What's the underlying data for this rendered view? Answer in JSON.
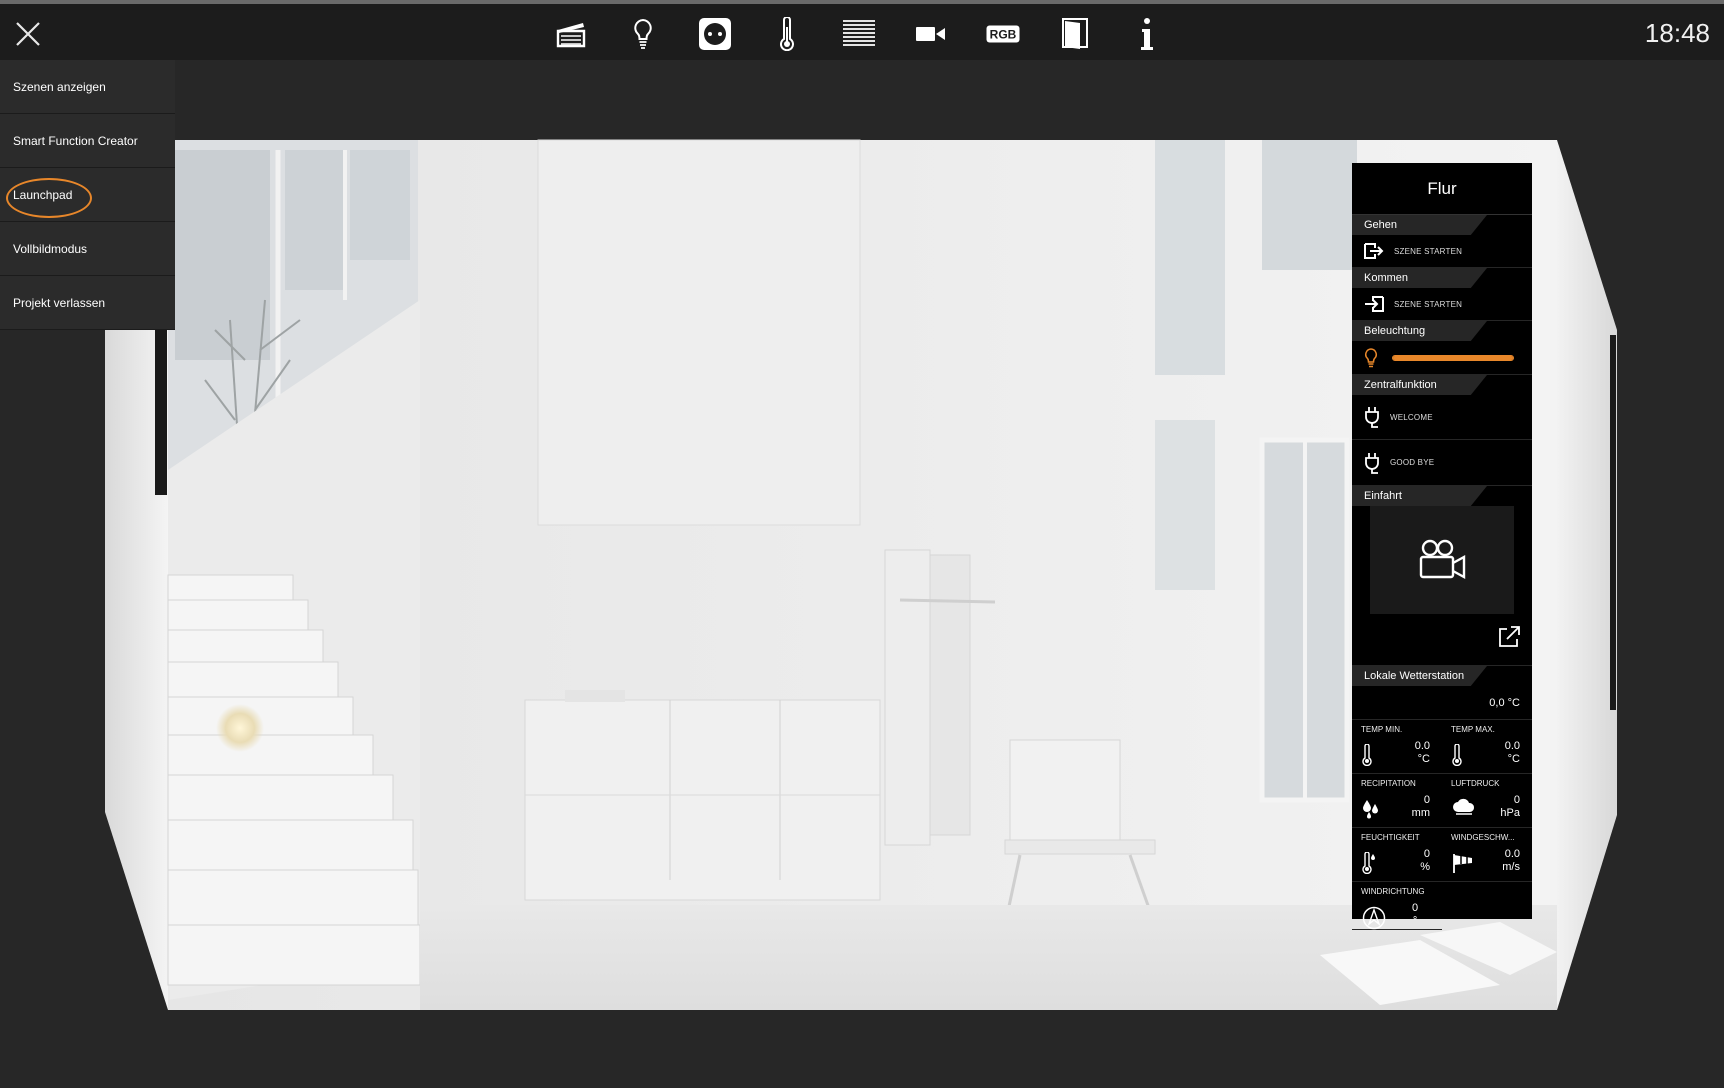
{
  "topbar": {
    "close_label": "close",
    "icons": [
      "scenes-icon",
      "bulb-icon",
      "socket-icon",
      "thermometer-icon",
      "blinds-icon",
      "camera-icon",
      "rgb-icon",
      "door-icon",
      "info-icon"
    ],
    "rgb_label": "RGB",
    "clock": "18:48"
  },
  "menu": {
    "items": [
      {
        "label": "Szenen anzeigen"
      },
      {
        "label": "Smart Function Creator"
      },
      {
        "label": "Launchpad"
      },
      {
        "label": "Vollbildmodus"
      },
      {
        "label": "Projekt verlassen"
      }
    ]
  },
  "panel": {
    "title": "Flur",
    "gehen": {
      "section": "Gehen",
      "action": "SZENE STARTEN"
    },
    "kommen": {
      "section": "Kommen",
      "action": "SZENE STARTEN"
    },
    "beleuchtung": {
      "section": "Beleuchtung",
      "level": 1.0
    },
    "zentral": {
      "section": "Zentralfunktion",
      "welcome": "WELCOME",
      "goodbye": "GOOD BYE"
    },
    "einfahrt": {
      "section": "Einfahrt"
    },
    "wetter": {
      "section": "Lokale Wetterstation",
      "temp": "0,0 °C",
      "cells": [
        {
          "label": "TEMP MIN.",
          "value": "0.0",
          "unit": "°C",
          "icon": "thermometer-icon"
        },
        {
          "label": "TEMP MAX.",
          "value": "0.0",
          "unit": "°C",
          "icon": "thermometer-icon"
        },
        {
          "label": "RECIPITATION",
          "value": "0",
          "unit": "mm",
          "icon": "rain-drops-icon"
        },
        {
          "label": "LUFTDRUCK",
          "value": "0",
          "unit": "hPa",
          "icon": "cloud-icon"
        },
        {
          "label": "FEUCHTIGKEIT",
          "value": "0",
          "unit": "%",
          "icon": "humidity-icon"
        },
        {
          "label": "WINDGESCHW...",
          "value": "0.0",
          "unit": "m/s",
          "icon": "windsock-icon"
        },
        {
          "label": "WINDRICHTUNG",
          "value": "0",
          "unit": "°",
          "icon": "compass-icon"
        }
      ]
    }
  },
  "colors": {
    "accent": "#e8872a",
    "panel": "#000000",
    "background": "#272727"
  }
}
